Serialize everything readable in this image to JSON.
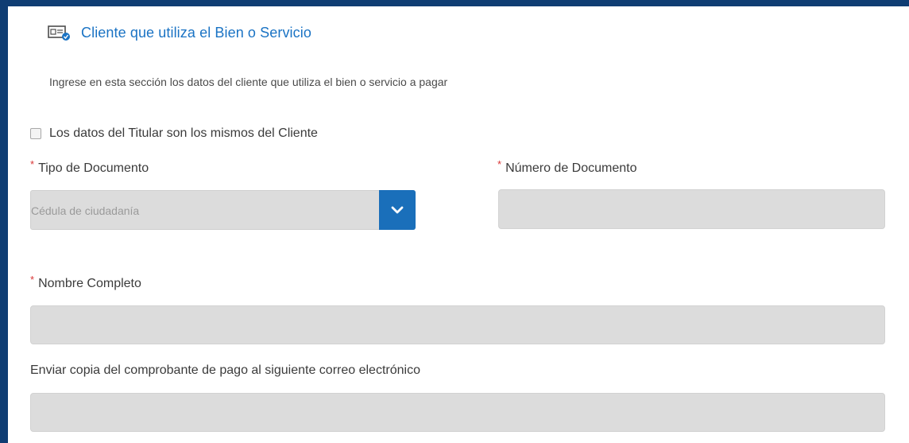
{
  "section": {
    "title": "Cliente que utiliza el Bien o Servicio",
    "description": "Ingrese en esta sección los datos del cliente que utiliza el bien o servicio a pagar",
    "icon": "id-card-icon"
  },
  "same_holder_checkbox": {
    "label": "Los datos del Titular son los mismos del Cliente",
    "checked": false
  },
  "fields": {
    "required_marker": "*",
    "document_type": {
      "label": "Tipo de Documento",
      "value": "Cédula de ciudadanía"
    },
    "document_number": {
      "label": "Número de Documento",
      "value": ""
    },
    "full_name": {
      "label": "Nombre Completo",
      "value": ""
    },
    "email_copy": {
      "label": "Enviar copia del comprobante de pago al siguiente correo electrónico",
      "value": ""
    }
  },
  "colors": {
    "frame": "#0f3d73",
    "title": "#1a73c4",
    "select_button": "#1a6fba",
    "input_background": "#dcdcdc",
    "required": "#d93636"
  }
}
